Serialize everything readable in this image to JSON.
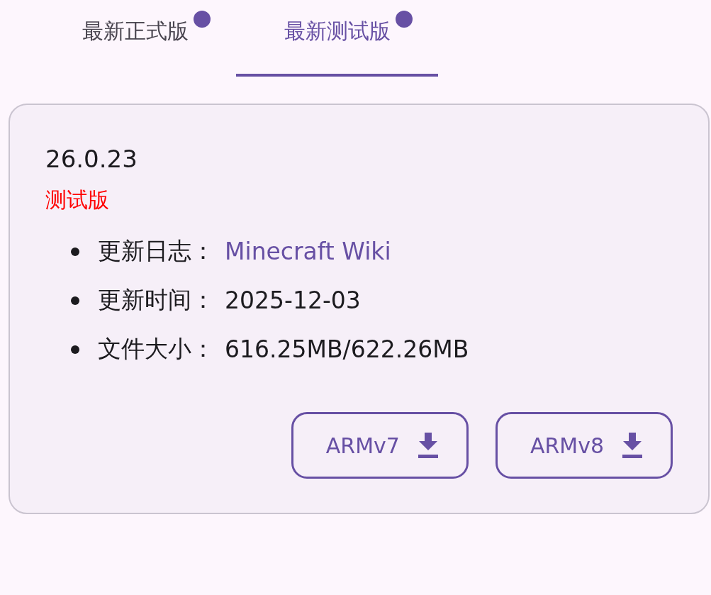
{
  "tabs": [
    {
      "label": "最新正式版",
      "selected": false,
      "badge": true
    },
    {
      "label": "最新测试版",
      "selected": true,
      "badge": true
    }
  ],
  "release": {
    "version": "26.0.23",
    "channel": "测试版",
    "details": [
      {
        "label": "更新日志：",
        "value": "Minecraft Wiki",
        "kind": "link"
      },
      {
        "label": "更新时间：",
        "value": "2025-12-03",
        "kind": "text"
      },
      {
        "label": "文件大小：",
        "value": "616.25MB/622.26MB",
        "kind": "text"
      }
    ],
    "downloads": [
      {
        "label": "ARMv7"
      },
      {
        "label": "ARMv8"
      }
    ]
  }
}
